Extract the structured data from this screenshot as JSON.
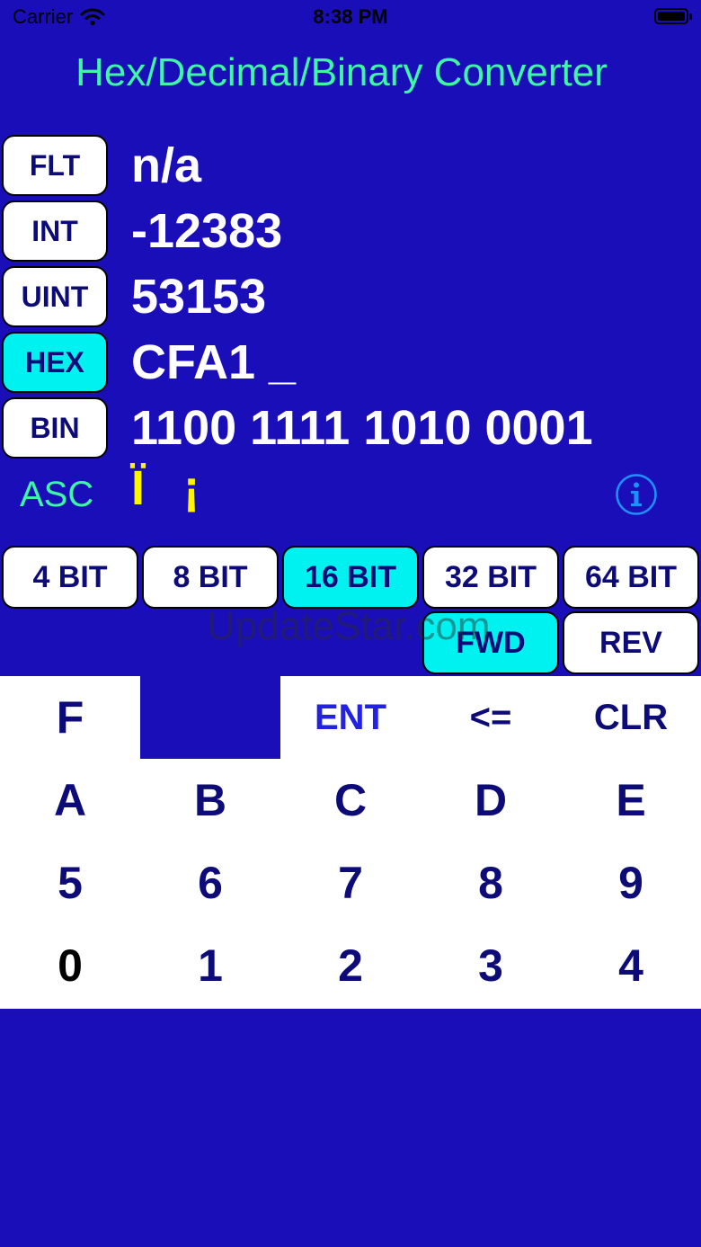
{
  "status_bar": {
    "carrier": "Carrier",
    "time": "8:38 PM"
  },
  "title": "Hex/Decimal/Binary Converter",
  "rows": [
    {
      "label": "FLT",
      "value": "n/a",
      "active": false
    },
    {
      "label": "INT",
      "value": "-12383",
      "active": false
    },
    {
      "label": "UINT",
      "value": "53153",
      "active": false
    },
    {
      "label": "HEX",
      "value": "CFA1 _",
      "active": true
    },
    {
      "label": "BIN",
      "value": "1100 1111 1010 0001",
      "active": false
    }
  ],
  "asc": {
    "label": "ASC",
    "value": "Ï ¡"
  },
  "bit_buttons": [
    {
      "label": "4 BIT",
      "active": false
    },
    {
      "label": "8 BIT",
      "active": false
    },
    {
      "label": "16 BIT",
      "active": true
    },
    {
      "label": "32 BIT",
      "active": false
    },
    {
      "label": "64 BIT",
      "active": false
    }
  ],
  "direction_buttons": [
    {
      "label": "FWD",
      "active": true
    },
    {
      "label": "REV",
      "active": false
    }
  ],
  "watermark": "UpdateStar.com",
  "keypad": {
    "row1": [
      "F",
      "",
      "ENT",
      "<=",
      "CLR"
    ],
    "row2": [
      "A",
      "B",
      "C",
      "D",
      "E"
    ],
    "row3": [
      "5",
      "6",
      "7",
      "8",
      "9"
    ],
    "row4": [
      "0",
      "1",
      "2",
      "3",
      "4"
    ]
  },
  "colors": {
    "background": "#1a0eb8",
    "title": "#3ef6a6",
    "active_button": "#00f2f0",
    "asc_value": "#fff400"
  }
}
